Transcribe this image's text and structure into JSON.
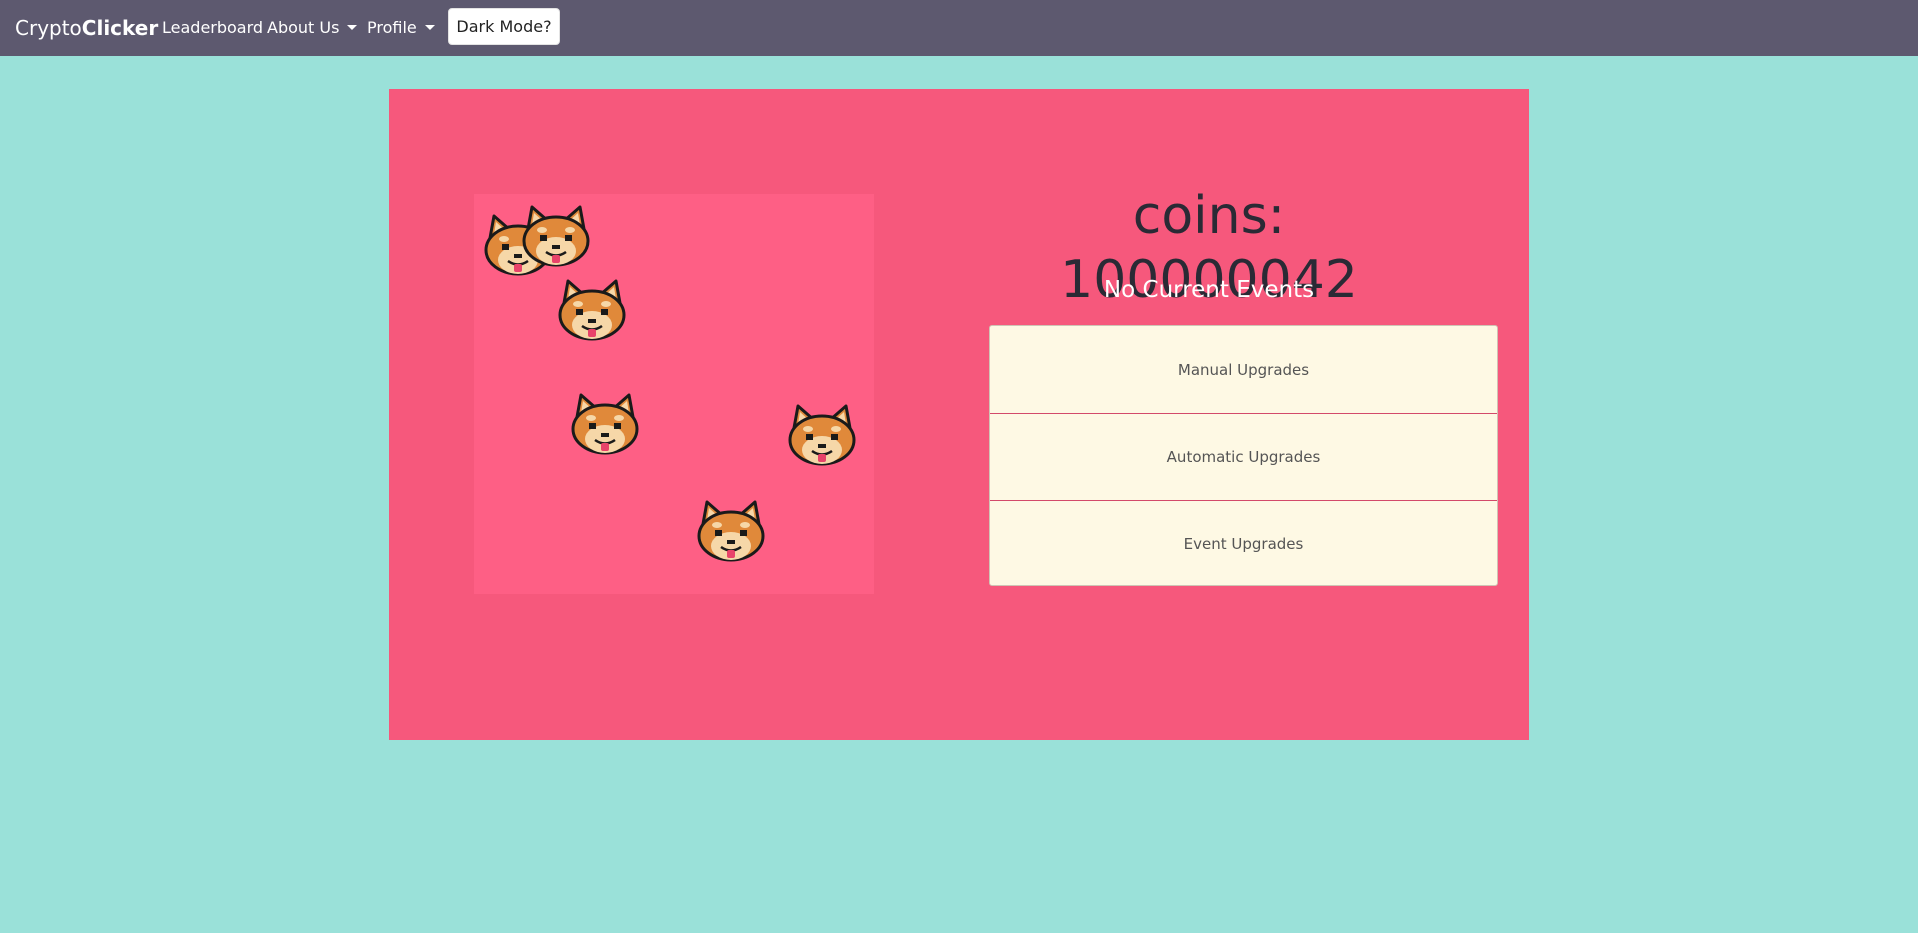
{
  "navbar": {
    "brand_light": "Crypto",
    "brand_bold": "Clicker",
    "links": {
      "leaderboard": "Leaderboard",
      "about": "About Us",
      "profile": "Profile"
    },
    "dark_mode_label": "Dark Mode?"
  },
  "game": {
    "coins_label": "coins: 100000042",
    "events_status": "No Current Events",
    "upgrades": {
      "manual": "Manual Upgrades",
      "automatic": "Automatic Upgrades",
      "event": "Event Upgrades"
    },
    "doge_icon": "shiba-inu-icon",
    "doge_count": 6
  },
  "colors": {
    "background": "#9ae1d9",
    "navbar": "#5d596f",
    "panel": "#f6587c",
    "click_area": "#fe5f85",
    "upgrade_bg": "#fef9e4"
  }
}
